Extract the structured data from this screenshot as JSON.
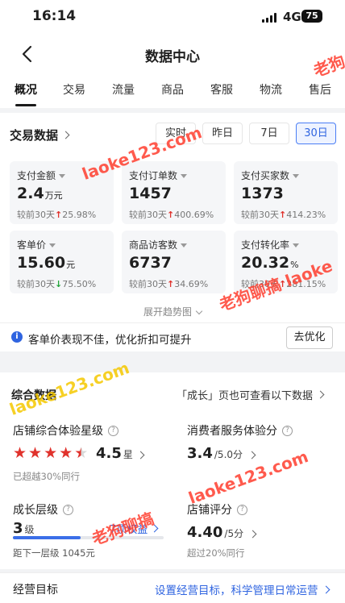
{
  "status_bar": {
    "time": "16:14",
    "network": "4G",
    "battery": "75"
  },
  "nav": {
    "title": "数据中心"
  },
  "tabs": [
    "概况",
    "交易",
    "流量",
    "商品",
    "客服",
    "物流",
    "售后"
  ],
  "trade": {
    "title": "交易数据",
    "ranges": [
      "实时",
      "昨日",
      "7日",
      "30日"
    ],
    "active_range": "30日",
    "metrics": [
      {
        "label": "支付金额",
        "value": "2.4",
        "unit": "万元",
        "compare": "较前30天",
        "dir": "up",
        "change": "25.98%"
      },
      {
        "label": "支付订单数",
        "value": "1457",
        "unit": "",
        "compare": "较前30天",
        "dir": "up",
        "change": "400.69%"
      },
      {
        "label": "支付买家数",
        "value": "1373",
        "unit": "",
        "compare": "较前30天",
        "dir": "up",
        "change": "414.23%"
      },
      {
        "label": "客单价",
        "value": "15.60",
        "unit": "元",
        "compare": "较前30天",
        "dir": "down",
        "change": "75.50%"
      },
      {
        "label": "商品访客数",
        "value": "6737",
        "unit": "",
        "compare": "较前30天",
        "dir": "up",
        "change": "34.69%"
      },
      {
        "label": "支付转化率",
        "value": "20.32",
        "unit": "%",
        "compare": "较前30天",
        "dir": "up",
        "change": "281.15%"
      }
    ],
    "expand": "展开趋势图"
  },
  "tip": {
    "text": "客单价表现不佳，优化折扣可提升",
    "button": "去优化"
  },
  "overview": {
    "title": "综合数据",
    "hint": "「成长」页也可查看以下数据",
    "store_rating": {
      "title": "店铺综合体验星级",
      "value": "4.5",
      "unit": "星",
      "stars": 4.5,
      "note": "已超越30%同行"
    },
    "service_score": {
      "title": "消费者服务体验分",
      "value": "3.4",
      "unit": "/5.0分"
    },
    "growth": {
      "title": "成长层级",
      "value": "3",
      "unit": "级",
      "rights": "7项权益",
      "next": "距下一层级 1045元",
      "progress": 0.45
    },
    "store_score": {
      "title": "店铺评分",
      "value": "4.40",
      "unit": "/5分",
      "note": "超过20%同行"
    }
  },
  "goal": {
    "label": "经营目标",
    "link": "设置经营目标，科学管理日常运营"
  },
  "watermark": {
    "text_cn": "老狗聊搞",
    "text_en": "laoke123.com"
  }
}
